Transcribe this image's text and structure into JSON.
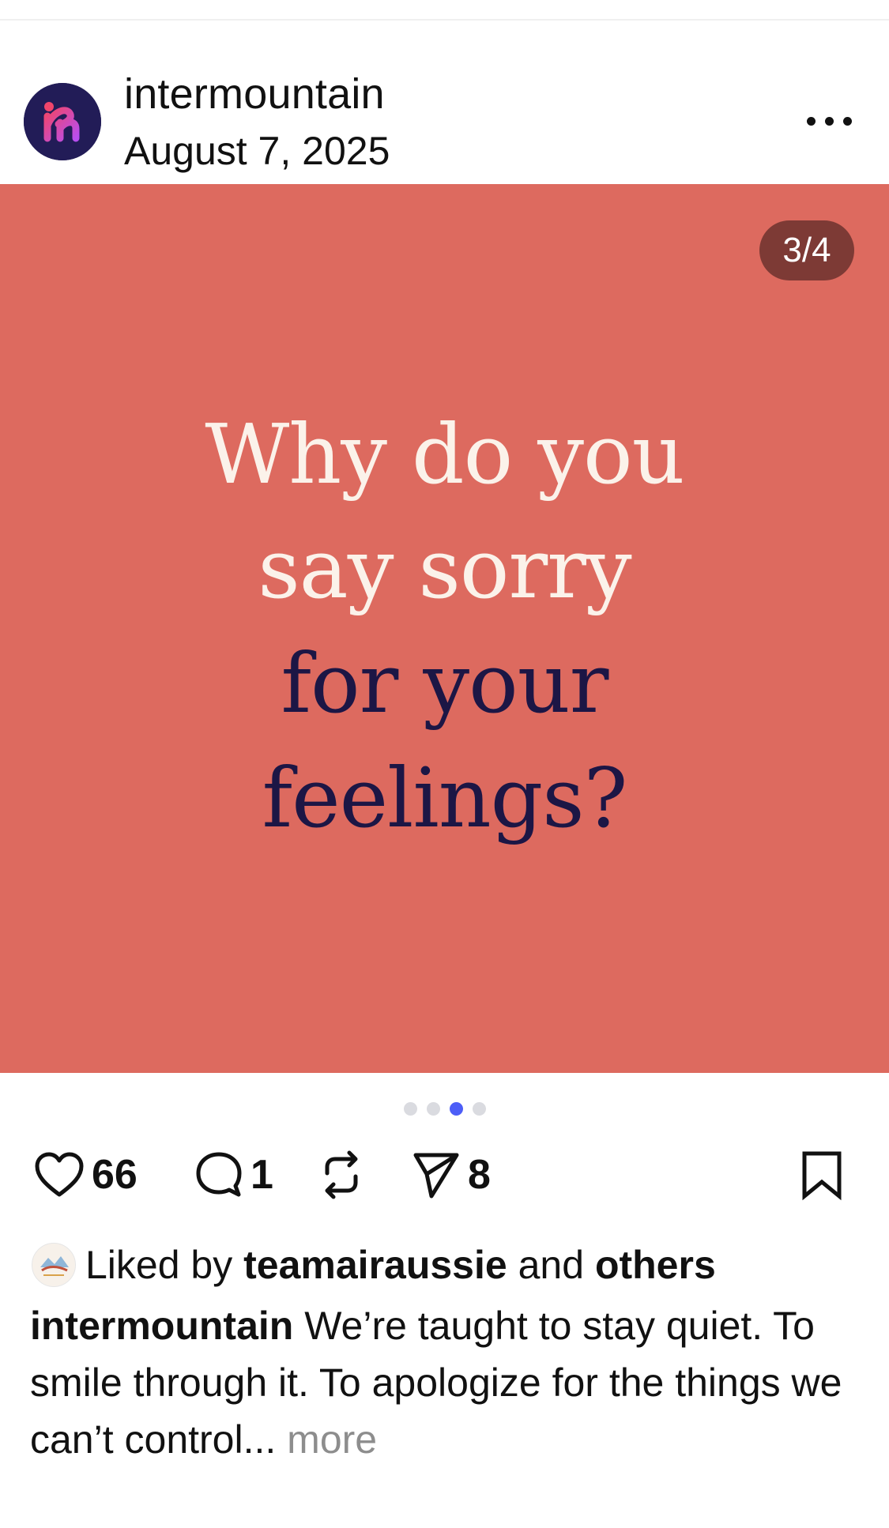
{
  "post": {
    "username": "intermountain",
    "date": "August 7, 2025",
    "more_menu_icon": "more-horizontal-icon"
  },
  "slide": {
    "counter": "3/4",
    "background": "#dd6a5f",
    "lines": [
      "Why do you",
      "say sorry",
      "for your",
      "feelings?"
    ],
    "light_text_color": "#fbf2ea",
    "dark_text_color": "#1c1645"
  },
  "carousel": {
    "total": 4,
    "active_index": 3,
    "active_color": "#4d5ef7"
  },
  "actions": {
    "likes": "66",
    "comments": "1",
    "shares": "8",
    "icons": [
      "heart-icon",
      "comment-icon",
      "repost-icon",
      "send-icon",
      "bookmark-icon"
    ]
  },
  "liked_by": {
    "prefix": "Liked by",
    "user": "teamairaussie",
    "middle": "and",
    "others": "others"
  },
  "caption": {
    "username": "intermountain",
    "text": "We’re taught to stay quiet. To smile through it. To apologize for the things we can’t control...",
    "more": "more"
  }
}
